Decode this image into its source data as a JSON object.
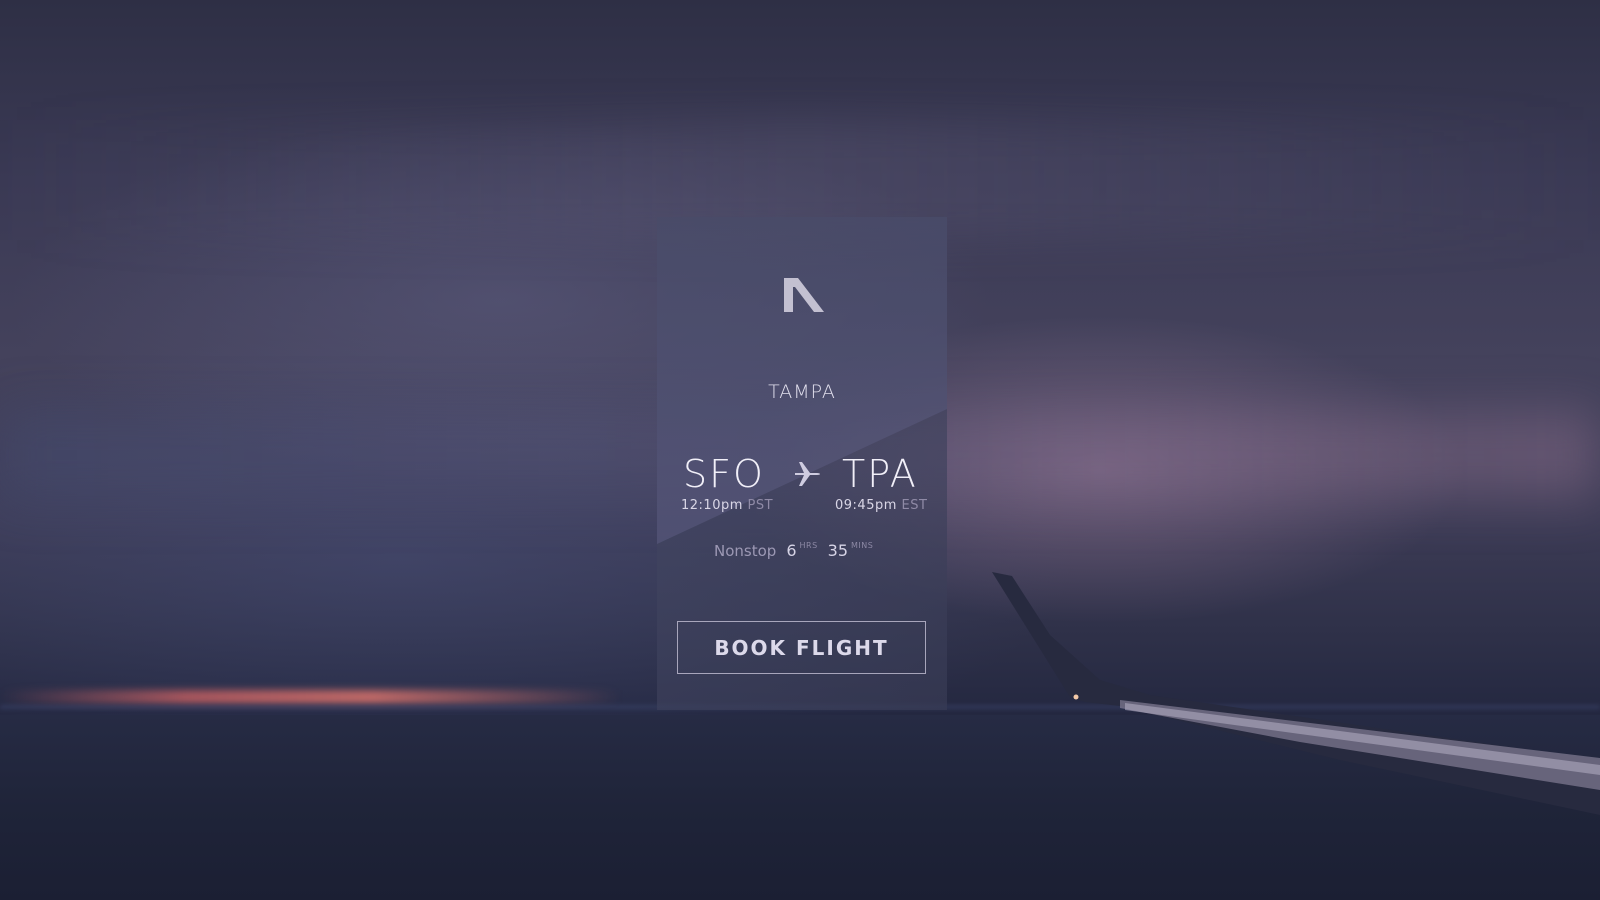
{
  "card": {
    "destination_city": "TAMPA",
    "origin_code": "SFO",
    "destination_code": "TPA",
    "departure_time": "12:10pm",
    "departure_tz": "PST",
    "arrival_time": "09:45pm",
    "arrival_tz": "EST",
    "stops": "Nonstop",
    "duration_hours": "6",
    "duration_hours_unit": "HRS",
    "duration_minutes": "35",
    "duration_minutes_unit": "MINS",
    "book_label": "BOOK FLIGHT"
  },
  "icons": {
    "logo": "brand-logo-icon",
    "route": "airplane-icon"
  },
  "colors": {
    "card_overlay": "#46486480",
    "text_primary": "#f1eff8",
    "text_muted": "#8f8aa6",
    "button_border": "#cdcade"
  }
}
